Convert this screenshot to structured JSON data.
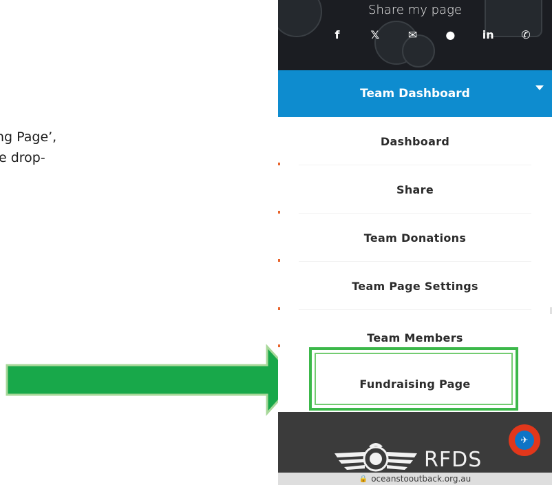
{
  "instructions": {
    "line1": "ng Page’,",
    "line2": "e drop-"
  },
  "share": {
    "title": "Share my page",
    "icons": [
      {
        "name": "facebook-icon",
        "glyph": "f"
      },
      {
        "name": "x-icon",
        "glyph": "𝕏"
      },
      {
        "name": "email-icon",
        "glyph": "✉"
      },
      {
        "name": "message-icon",
        "glyph": "●"
      },
      {
        "name": "linkedin-icon",
        "glyph": "in"
      },
      {
        "name": "whatsapp-icon",
        "glyph": "✆"
      }
    ]
  },
  "team_dashboard": {
    "label": "Team Dashboard"
  },
  "menu": {
    "items": [
      {
        "label": "Dashboard"
      },
      {
        "label": "Share"
      },
      {
        "label": "Team Donations"
      },
      {
        "label": "Team Page Settings"
      },
      {
        "label": "Team Members"
      },
      {
        "label": "Fundraising Page"
      }
    ]
  },
  "footer": {
    "brand": "RFDS"
  },
  "browser": {
    "url": "oceanstooutback.org.au"
  },
  "colors": {
    "accent_blue": "#0e8ccf",
    "highlight_green": "#3cb84a",
    "arrow_green": "#18a84a",
    "fab_red": "#e2371b"
  }
}
